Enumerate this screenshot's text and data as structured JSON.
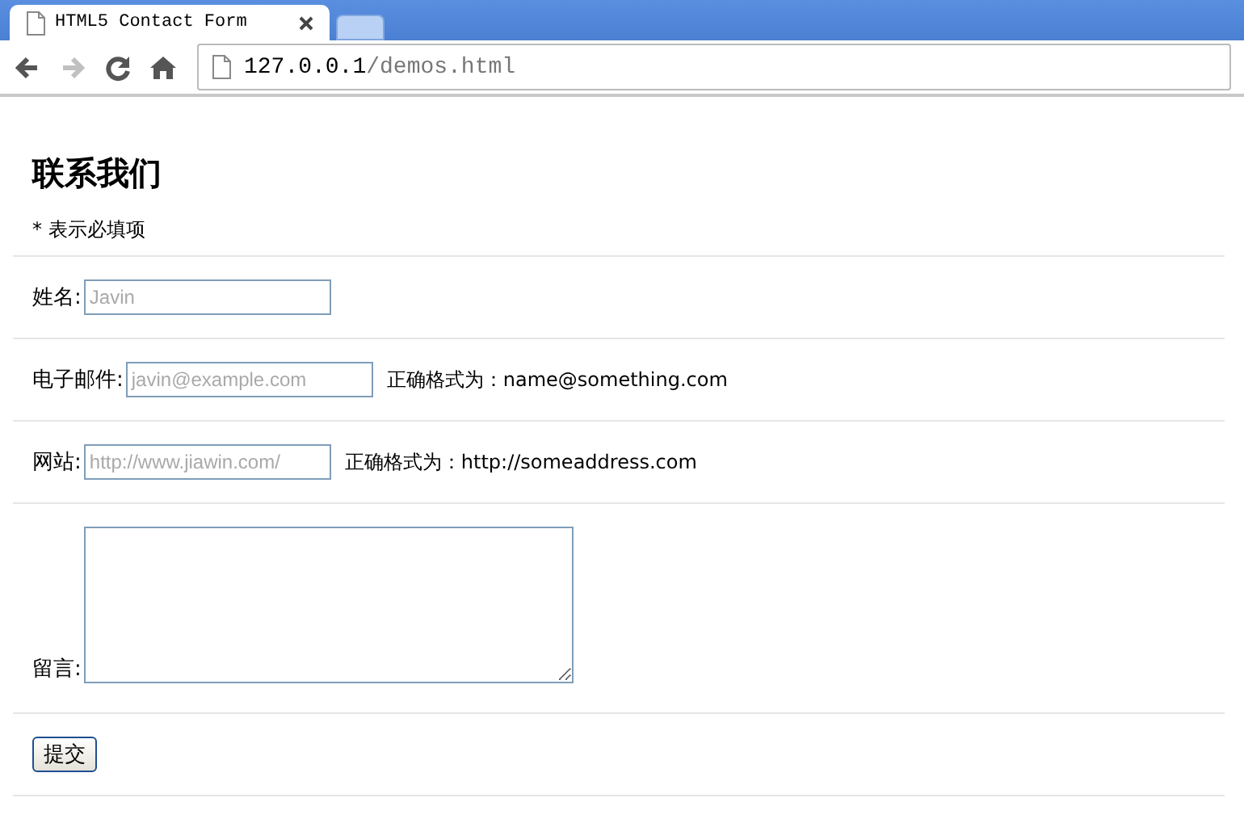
{
  "browser": {
    "tabs": [
      {
        "title": "HTML5 Contact Form",
        "kind": "page",
        "selected": true
      },
      {
        "kind": "new"
      }
    ],
    "nav": {
      "back_disabled": false,
      "forward_disabled": true
    },
    "address": {
      "host": "127.0.0.1",
      "path": "/demos.html"
    }
  },
  "form": {
    "title": "联系我们",
    "note": "* 表示必填项",
    "fields": [
      {
        "kind": "text",
        "label": "姓名:",
        "placeholder": "Javin"
      },
      {
        "kind": "text",
        "label": "电子邮件:",
        "placeholder": "javin@example.com",
        "hint": "正确格式为：name@something.com"
      },
      {
        "kind": "text",
        "label": "网站:",
        "placeholder": "http://www.jiawin.com/",
        "hint": "正确格式为：http://someaddress.com"
      },
      {
        "kind": "textarea",
        "label": "留言:"
      }
    ],
    "submit": "提交"
  }
}
